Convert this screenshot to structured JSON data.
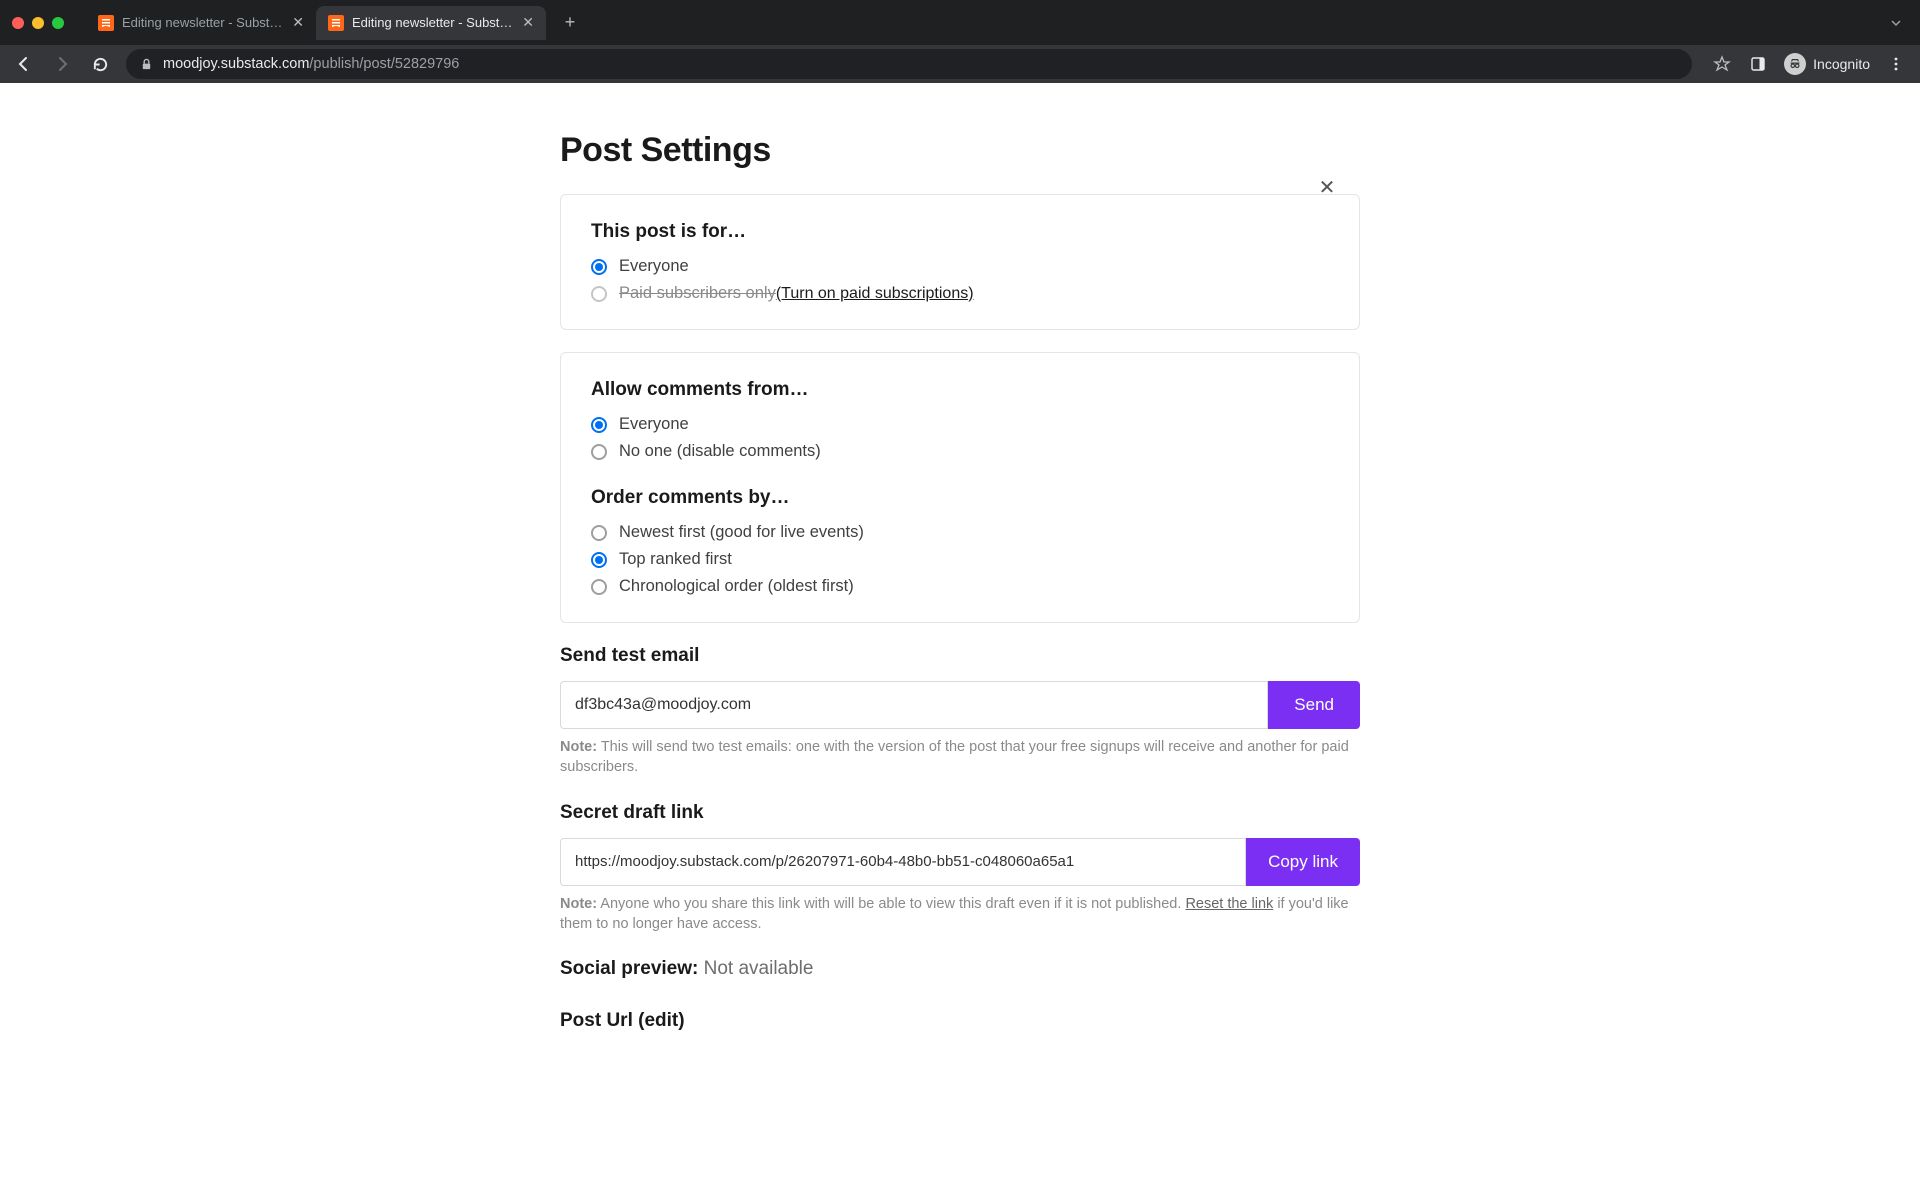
{
  "browser": {
    "tabs": [
      {
        "title": "Editing newsletter - Substack",
        "active": false
      },
      {
        "title": "Editing newsletter - Substack",
        "active": true
      }
    ],
    "url_domain": "moodjoy.substack.com",
    "url_path": "/publish/post/52829796",
    "incognito_label": "Incognito"
  },
  "page": {
    "title": "Post Settings",
    "audience": {
      "heading": "This post is for…",
      "options": [
        {
          "label": "Everyone",
          "selected": true,
          "disabled": false
        },
        {
          "label": "Paid subscribers only",
          "selected": false,
          "disabled": true,
          "link_suffix": "(Turn on paid subscriptions)"
        }
      ]
    },
    "comments": {
      "allow_heading": "Allow comments from…",
      "allow_options": [
        {
          "label": "Everyone",
          "selected": true
        },
        {
          "label": "No one (disable comments)",
          "selected": false
        }
      ],
      "order_heading": "Order comments by…",
      "order_options": [
        {
          "label": "Newest first (good for live events)",
          "selected": false
        },
        {
          "label": "Top ranked first",
          "selected": true
        },
        {
          "label": "Chronological order (oldest first)",
          "selected": false
        }
      ]
    },
    "test_email": {
      "heading": "Send test email",
      "value": "df3bc43a@moodjoy.com",
      "button": "Send",
      "note_prefix": "Note:",
      "note_body": " This will send two test emails: one with the version of the post that your free signups will receive and another for paid subscribers."
    },
    "draft_link": {
      "heading": "Secret draft link",
      "value": "https://moodjoy.substack.com/p/26207971-60b4-48b0-bb51-c048060a65a1",
      "button": "Copy link",
      "note_prefix": "Note:",
      "note_body_1": " Anyone who you share this link with will be able to view this draft even if it is not published. ",
      "note_link": "Reset the link",
      "note_body_2": " if you'd like them to no longer have access."
    },
    "social_preview": {
      "label": "Social preview:",
      "value": " Not available"
    },
    "post_url_heading": "Post Url (edit)"
  }
}
